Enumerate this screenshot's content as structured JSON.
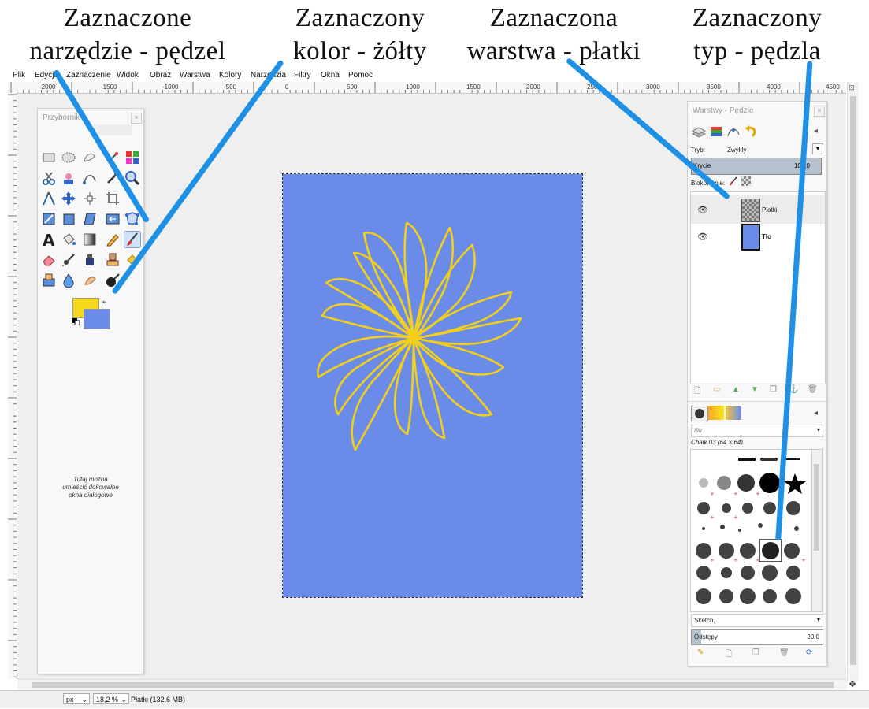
{
  "annotations": {
    "tool": [
      "Zaznaczone",
      "narzędzie - pędzel"
    ],
    "color": [
      "Zaznaczony",
      "kolor - żółty"
    ],
    "layer": [
      "Zaznaczona",
      "warstwa - płatki"
    ],
    "brush": [
      "Zaznaczony",
      "typ - pędzla"
    ]
  },
  "menu": [
    "Plik",
    "Edycja",
    "Zaznaczenie",
    "Widok",
    "Obraz",
    "Warstwa",
    "Kolory",
    "Narzędzia",
    "Filtry",
    "Okna",
    "Pomoc"
  ],
  "ruler_ticks": [
    "-2000",
    "-1500",
    "-1000",
    "-500",
    "0",
    "500",
    "1000",
    "1500",
    "2000",
    "2500",
    "3000",
    "3500",
    "4000",
    "4500"
  ],
  "toolbox": {
    "title": "Przybornik",
    "dock_note": "Tutaj można umieścić dokowalne okna dialogowe",
    "fg_color": "#f6d71c",
    "bg_color": "#6b8be9"
  },
  "image": {
    "background": "#6b8be9",
    "stroke": "#f2cf1b"
  },
  "layers_panel": {
    "title": "Warstwy - Pędzle",
    "mode_label": "Tryb:",
    "mode_value": "Zwykły",
    "opacity_label": "Krycie",
    "opacity_value": "100,0",
    "lock_label": "Blokowanie:",
    "layers": [
      {
        "name": "Płatki",
        "selected": true
      },
      {
        "name": "Tło",
        "selected": false
      }
    ],
    "filter_placeholder": "filtr",
    "brush_name": "Chalk 03 (64 × 64)",
    "brush_tag": "Sketch,",
    "spacing_label": "Odstępy",
    "spacing_value": "20,0"
  },
  "status": {
    "unit": "px",
    "zoom": "18,2 %",
    "info": "Płatki (132,6 MB)"
  },
  "colors": {
    "pointer": "#1e90e6",
    "selection": "#cfe2f7"
  }
}
